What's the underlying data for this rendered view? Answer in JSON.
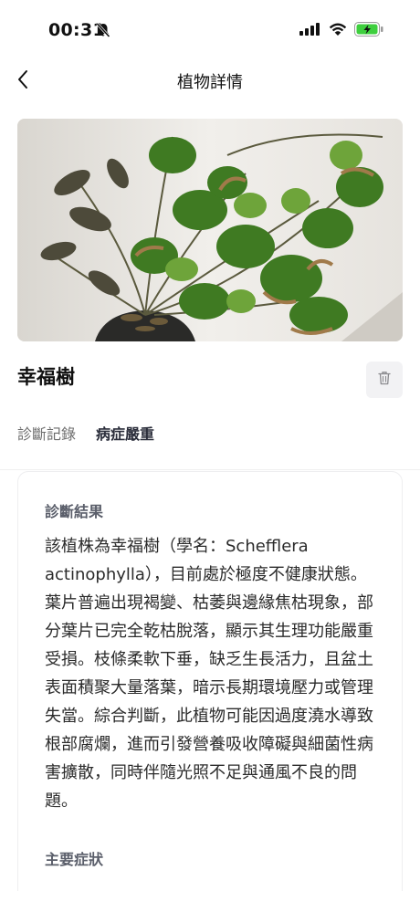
{
  "status_bar": {
    "time": "00:31",
    "icons": [
      "bell-muted-icon",
      "cellular-signal-icon",
      "wifi-icon",
      "battery-charging-icon"
    ],
    "battery_color": "#3ecf3e"
  },
  "nav": {
    "back_icon": "chevron-left-icon",
    "title": "植物詳情"
  },
  "plant": {
    "photo_alt": "幸福樹",
    "name": "幸福樹",
    "delete_icon": "trash-icon"
  },
  "record": {
    "label": "診斷記錄",
    "status": "病症嚴重"
  },
  "diagnosis": {
    "result_heading": "診斷結果",
    "result_text": "該植株為幸福樹（學名：Schefflera actinophylla），目前處於極度不健康狀態。葉片普遍出現褐變、枯萎與邊緣焦枯現象，部分葉片已完全乾枯脫落，顯示其生理功能嚴重受損。枝條柔軟下垂，缺乏生長活力，且盆土表面積聚大量落葉，暗示長期環境壓力或管理失當。綜合判斷，此植物可能因過度澆水導致根部腐爛，進而引發營養吸收障礙與細菌性病害擴散，同時伴隨光照不足與通風不良的問題。",
    "symptoms_heading": "主要症狀"
  },
  "colors": {
    "status_severe_text": "#2a2d3a",
    "card_heading": "#5a5e6a"
  }
}
